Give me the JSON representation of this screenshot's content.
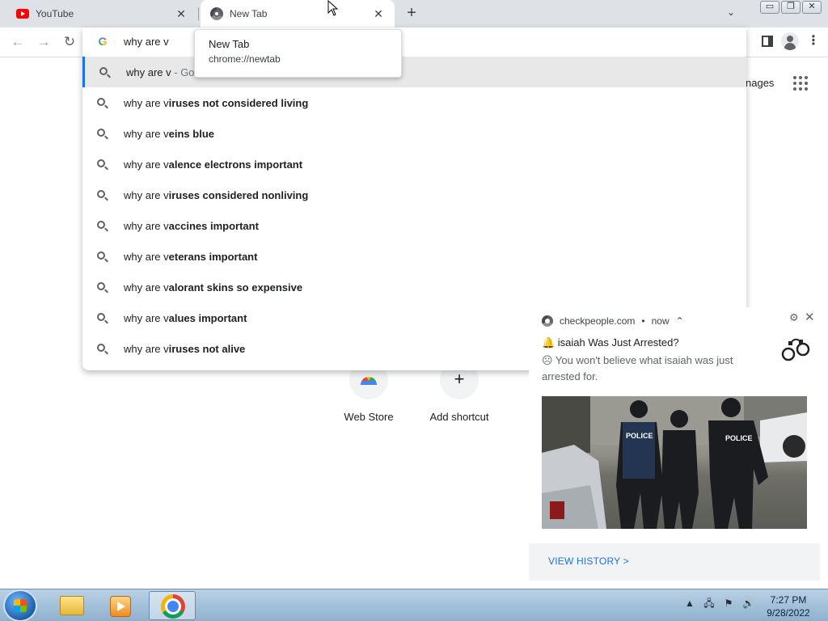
{
  "tabs": [
    {
      "title": "YouTube",
      "close": "✕"
    },
    {
      "title": "New Tab",
      "close": "✕"
    }
  ],
  "tabstrip": {
    "new_tab": "+",
    "tab_search": "⌄"
  },
  "window_controls": {
    "minimize": "▭",
    "restore": "❐",
    "close": "✕"
  },
  "toolbar": {
    "back": "←",
    "forward": "→",
    "reload": "↻",
    "menu": "⋮"
  },
  "omnibox": {
    "input_value": "why are v",
    "suggestions": [
      {
        "prefix": "why are v",
        "suffix": "",
        "extra": " - Go"
      },
      {
        "prefix": "why are v",
        "suffix": "iruses not considered living",
        "extra": ""
      },
      {
        "prefix": "why are v",
        "suffix": "eins blue",
        "extra": ""
      },
      {
        "prefix": "why are v",
        "suffix": "alence electrons important",
        "extra": ""
      },
      {
        "prefix": "why are v",
        "suffix": "iruses considered nonliving",
        "extra": ""
      },
      {
        "prefix": "why are v",
        "suffix": "accines important",
        "extra": ""
      },
      {
        "prefix": "why are v",
        "suffix": "eterans important",
        "extra": ""
      },
      {
        "prefix": "why are v",
        "suffix": "alorant skins so expensive",
        "extra": ""
      },
      {
        "prefix": "why are v",
        "suffix": "alues important",
        "extra": ""
      },
      {
        "prefix": "why are v",
        "suffix": "iruses not alive",
        "extra": ""
      }
    ]
  },
  "tooltip": {
    "title": "New Tab",
    "url": "chrome://newtab"
  },
  "ntp": {
    "images_link": "nages",
    "shortcuts": [
      {
        "label": "Web Store"
      },
      {
        "label": "Add shortcut",
        "glyph": "+"
      }
    ]
  },
  "notification": {
    "site": "checkpeople.com",
    "dot": "•",
    "time": "now",
    "caret": "⌃",
    "settings": "⚙",
    "close": "✕",
    "title": "🔔 isaiah Was Just Arrested?",
    "body": "☹ You won't believe what isaiah was just arrested for.",
    "image_caption": "POLICE",
    "action": "VIEW HISTORY >"
  },
  "taskbar": {
    "tray": {
      "up_arrow": "▲",
      "network": "🖧",
      "flag": "⚑",
      "volume": "🔊"
    },
    "time": "7:27 PM",
    "date": "9/28/2022"
  },
  "colors": {
    "accent": "#1a73e8",
    "tabstrip_bg": "#dee1e6",
    "youtube_red": "#ff0000",
    "taskbar_top": "#b9d0e4"
  }
}
